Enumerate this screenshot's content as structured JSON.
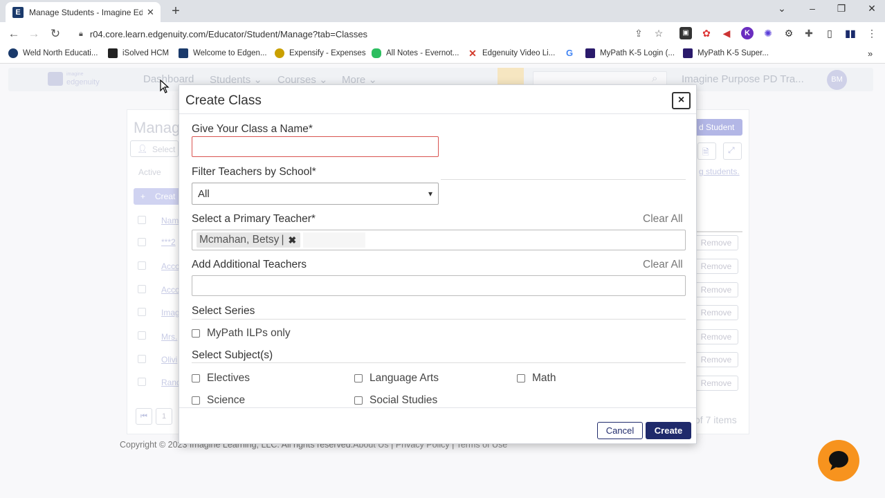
{
  "browser": {
    "tab_title": "Manage Students - Imagine Edgenuity",
    "url": "r04.core.learn.edgenuity.com/Educator/Student/Manage?tab=Classes",
    "bookmarks": [
      {
        "label": "Weld North Educati...",
        "color": "#1a3a6b"
      },
      {
        "label": "iSolved HCM",
        "color": "#222222"
      },
      {
        "label": "Welcome to Edgen...",
        "color": "#1a3a6b"
      },
      {
        "label": "Expensify - Expenses",
        "color": "#caa000"
      },
      {
        "label": "All Notes - Evernot...",
        "color": "#2dbe60"
      },
      {
        "label": "Edgenuity Video Li...",
        "color": "#d33b2c"
      },
      {
        "label": "MyPath K-5 Login (...",
        "color": "#2a1a6b"
      },
      {
        "label": "MyPath K-5 Super...",
        "color": "#2a1a6b"
      }
    ]
  },
  "app": {
    "logo_line1": "imagine",
    "logo_line2": "edgenuity",
    "nav": {
      "dashboard": "Dashboard",
      "students": "Students",
      "courses": "Courses",
      "more": "More"
    },
    "org_name": "Imagine Purpose PD Tra...",
    "avatar_initials": "BM"
  },
  "background_page": {
    "title_fragment": "Manag",
    "select_fragment": "Select",
    "active_label": "Active",
    "create_fragment": "Creat",
    "name_col_fragment": "Nam",
    "add_student_fragment": "d Student",
    "students_link_fragment": "g students.",
    "row_fragments": [
      "***2",
      "Acco",
      "Acco",
      "Imag",
      "Mrs.",
      "Olivi",
      "Rand"
    ],
    "remove_label": "Remove",
    "pager_first": "1",
    "items_count_fragment": "of 7 items"
  },
  "footer": {
    "copyright": "Copyright © 2023 Imagine Learning, LLC. All rights reserved.",
    "about": "About Us",
    "privacy": "Privacy Policy",
    "terms": "Terms of Use",
    "sep": "|"
  },
  "modal": {
    "title": "Create Class",
    "close_glyph": "×",
    "class_name_label": "Give Your Class a Name*",
    "class_name_value": "",
    "filter_school_label": "Filter Teachers by School*",
    "filter_school_selected": "All",
    "primary_teacher_label": "Select a Primary Teacher*",
    "clear_all": "Clear All",
    "primary_teacher_tag": "Mcmahan, Betsy",
    "additional_teachers_label": "Add Additional Teachers",
    "additional_teachers_value": "",
    "series_label": "Select Series",
    "series_option": "MyPath ILPs only",
    "subjects_label": "Select Subject(s)",
    "subjects": [
      "Electives",
      "Language Arts",
      "Math",
      "Science",
      "Social Studies"
    ],
    "cancel": "Cancel",
    "create": "Create"
  }
}
